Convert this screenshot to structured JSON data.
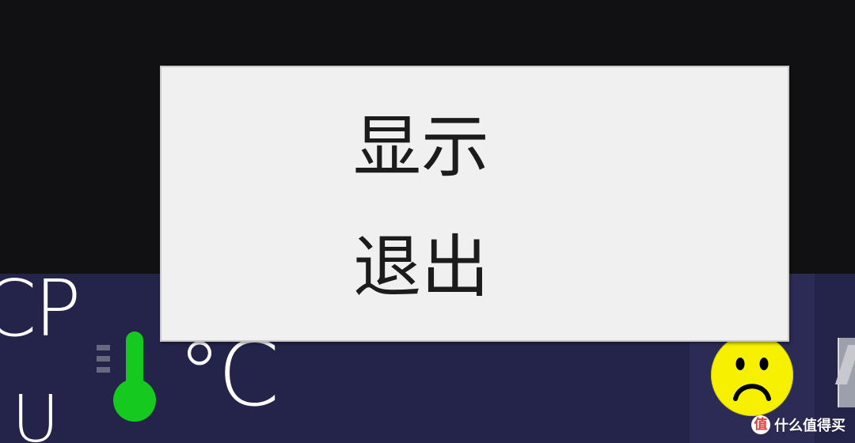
{
  "tray": {
    "cp_text": "CP",
    "u_text": "U",
    "temperature_unit": "°C",
    "thermometer_icon": "thermometer-icon",
    "status_icon": "sad-face-icon",
    "colors": {
      "taskbar": "#24234a",
      "thermometer": "#15c91f",
      "status_face": "#f6f100"
    }
  },
  "context_menu": {
    "items": [
      {
        "label": "显示"
      },
      {
        "label": "退出"
      }
    ]
  },
  "watermark": {
    "logo": "值",
    "text": "什么值得买"
  }
}
